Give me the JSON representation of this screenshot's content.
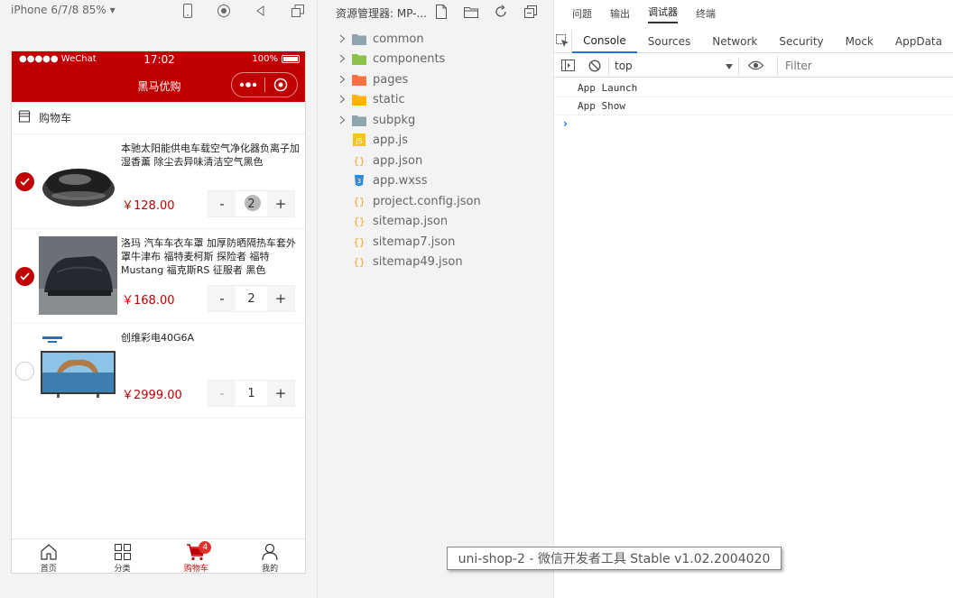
{
  "simulator": {
    "device_label": "iPhone 6/7/8 85% ▾",
    "statusbar": {
      "carrier": "●●●●● WeChat",
      "time": "17:02",
      "battery": "100%"
    },
    "navbar_title": "黑马优购",
    "cart_header": "购物车",
    "goods": [
      {
        "name": "本驰太阳能供电车载空气净化器负离子加湿香薰 除尘去异味清洁空气黑色",
        "price": "￥128.00",
        "count": "2",
        "checked": true
      },
      {
        "name": "洛玛 汽车车衣车罩 加厚防晒隔热车套外罩牛津布 福特麦柯斯 探险者 福特Mustang 福克斯RS 征服者 黑色",
        "price": "￥168.00",
        "count": "2",
        "checked": true
      },
      {
        "name": "创维彩电40G6A",
        "price": "￥2999.00",
        "count": "1",
        "checked": false
      }
    ],
    "stepper_minus": "-",
    "stepper_plus": "+",
    "tabbar": [
      {
        "label": "首页",
        "icon": "home-icon"
      },
      {
        "label": "分类",
        "icon": "grid-icon"
      },
      {
        "label": "购物车",
        "icon": "cart-icon",
        "badge": "4",
        "active": true
      },
      {
        "label": "我的",
        "icon": "user-icon"
      }
    ],
    "accent": "#c00000"
  },
  "explorer": {
    "title": "资源管理器: MP-...",
    "items": [
      {
        "label": "common",
        "type": "folder",
        "color": "#90a4ae"
      },
      {
        "label": "components",
        "type": "folder",
        "color": "#8bc34a"
      },
      {
        "label": "pages",
        "type": "folder",
        "color": "#ff7043"
      },
      {
        "label": "static",
        "type": "folder",
        "color": "#ffb300"
      },
      {
        "label": "subpkg",
        "type": "folder",
        "color": "#90a4ae"
      },
      {
        "label": "app.js",
        "type": "js"
      },
      {
        "label": "app.json",
        "type": "json"
      },
      {
        "label": "app.wxss",
        "type": "css"
      },
      {
        "label": "project.config.json",
        "type": "json"
      },
      {
        "label": "sitemap.json",
        "type": "json"
      },
      {
        "label": "sitemap7.json",
        "type": "json"
      },
      {
        "label": "sitemap49.json",
        "type": "json"
      }
    ]
  },
  "devtools": {
    "top_tabs": [
      "问题",
      "输出",
      "调试器",
      "终端"
    ],
    "top_active": "调试器",
    "tabs": [
      "Console",
      "Sources",
      "Network",
      "Security",
      "Mock",
      "AppData"
    ],
    "active_tab": "Console",
    "context": "top",
    "filter_placeholder": "Filter",
    "logs": [
      "App  Launch",
      "App  Show"
    ],
    "prompt": "›"
  },
  "window_title": "uni-shop-2 - 微信开发者工具 Stable v1.02.2004020"
}
